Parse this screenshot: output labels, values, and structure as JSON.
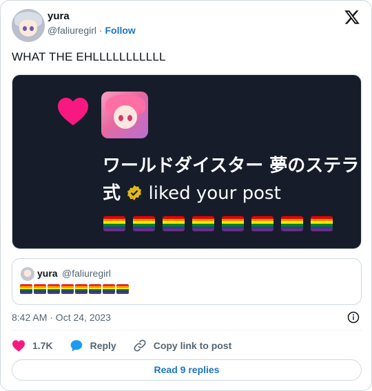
{
  "colors": {
    "accent": "#1d74c4",
    "like": "#f91880",
    "media_bg": "#161c2a",
    "secondary_text": "#536471"
  },
  "author": {
    "name": "yura",
    "handle": "@faliuregirl",
    "separator": "·",
    "follow_label": "Follow"
  },
  "tweet": {
    "text": "WHAT THE EHLLLLLLLLLLL"
  },
  "media": {
    "notification_title": "ワールドダイスター 夢のステラ",
    "notification_title_line2": "式",
    "notification_action": "liked your post",
    "flags_count": 8,
    "icons": [
      "heart-icon",
      "app-icon",
      "verified-badge-icon",
      "rainbow-flag-icon"
    ]
  },
  "quote": {
    "name": "yura",
    "handle": "@faliuregirl",
    "flags_count": 8
  },
  "meta": {
    "timestamp": "8:42 AM · Oct 24, 2023"
  },
  "actions": {
    "like_count": "1.7K",
    "reply_label": "Reply",
    "copy_label": "Copy link to post"
  },
  "footer": {
    "read_replies_label": "Read 9 replies"
  }
}
